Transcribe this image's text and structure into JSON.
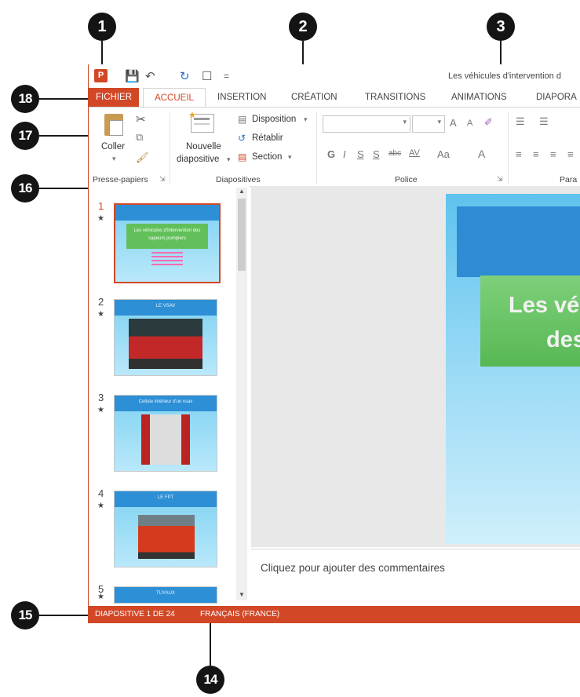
{
  "window": {
    "doc_title": "Les véhicules d'intervention d",
    "qat": {
      "app_icon": "P",
      "save_icon": "save-icon",
      "undo_icon": "undo-icon",
      "redo_icon": "redo-icon",
      "new_icon": "new-icon",
      "customize": "="
    }
  },
  "tabs": [
    "FICHIER",
    "ACCUEIL",
    "INSERTION",
    "CRÉATION",
    "TRANSITIONS",
    "ANIMATIONS",
    "DIAPORA"
  ],
  "ribbon": {
    "clipboard": {
      "paste_label": "Coller",
      "group_label": "Presse-papiers"
    },
    "slides": {
      "new_slide_line1": "Nouvelle",
      "new_slide_line2": "diapositive",
      "layout": "Disposition",
      "reset": "Rétablir",
      "section": "Section",
      "group_label": "Diapositives"
    },
    "font": {
      "group_label": "Police",
      "bold": "G",
      "italic": "I",
      "underline": "S",
      "shadow": "S",
      "strike": "abc",
      "spacing": "AV",
      "case": "Aa",
      "color": "A",
      "grow": "A",
      "shrink": "A"
    },
    "paragraph": {
      "group_label": "Para"
    }
  },
  "thumbnails": [
    {
      "num": "1",
      "title": "Les véhicules d'intervention des sapeurs pompiers",
      "selected": true
    },
    {
      "num": "2",
      "title": "LE VSAV"
    },
    {
      "num": "3",
      "title": "Cellule intérieur d'un vsav"
    },
    {
      "num": "4",
      "title": "LE FPT"
    },
    {
      "num": "5",
      "title": "TUYAUX"
    }
  ],
  "slide": {
    "title_line1": "Les vé",
    "title_line2": "des"
  },
  "notes": {
    "placeholder": "Cliquez pour ajouter des commentaires"
  },
  "status": {
    "slide_count": "DIAPOSITIVE 1 DE 24",
    "language": "FRANÇAIS (FRANCE)"
  },
  "callouts": [
    "1",
    "2",
    "3",
    "18",
    "17",
    "16",
    "15",
    "14"
  ],
  "colors": {
    "accent": "#d24726",
    "callout": "#141414",
    "slide_blue": "#2f8bd3",
    "slide_green": "#5dbb58"
  }
}
